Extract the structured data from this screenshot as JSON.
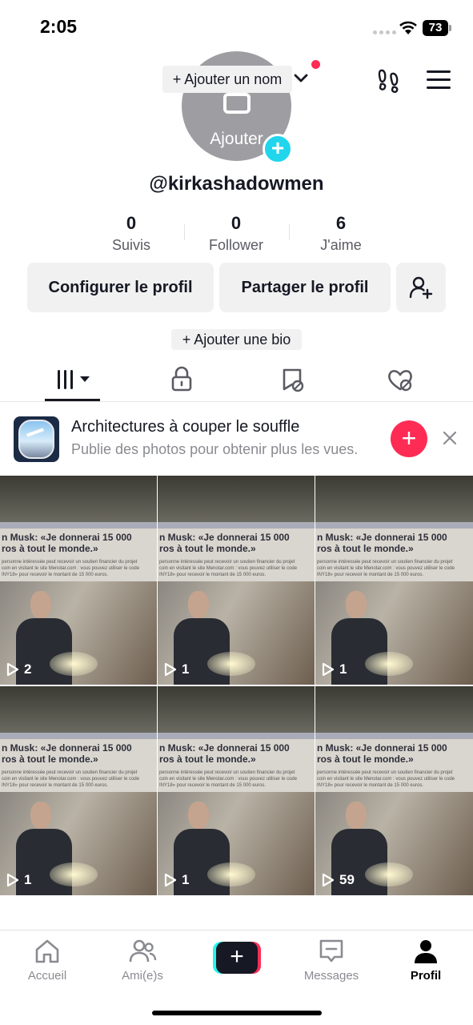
{
  "status_bar": {
    "time": "2:05",
    "battery": "73"
  },
  "profile": {
    "add_name_label": "+ Ajouter un nom",
    "avatar_label": "Ajouter",
    "username": "@kirkashadowmen",
    "add_bio_label": "+ Ajouter une bio"
  },
  "stats": [
    {
      "value": "0",
      "label": "Suivis"
    },
    {
      "value": "0",
      "label": "Follower"
    },
    {
      "value": "6",
      "label": "J'aime"
    }
  ],
  "actions": {
    "edit_profile": "Configurer le profil",
    "share_profile": "Partager le profil"
  },
  "tabs": [
    {
      "icon": "grid-icon",
      "active": true
    },
    {
      "icon": "lock-icon",
      "active": false
    },
    {
      "icon": "bookmark-icon",
      "active": false
    },
    {
      "icon": "liked-heart-icon",
      "active": false
    }
  ],
  "banner": {
    "title": "Architectures à couper le souffle",
    "subtitle": "Publie des photos pour obtenir plus les vues."
  },
  "video_tile": {
    "headline_1": "n Musk: «Je donnerai 15 000",
    "headline_2": "ros à tout le monde.»",
    "body_1": "personne intéressée peut recevoir un soutien financier du projet",
    "body_2": "coin en visitant le site Menotar.com : vous pouvez utiliser le code",
    "body_3": "INY18» pour recevoir le montant de 15 000 euros."
  },
  "videos": [
    {
      "views": "2"
    },
    {
      "views": "1"
    },
    {
      "views": "1"
    },
    {
      "views": "1"
    },
    {
      "views": "1"
    },
    {
      "views": "59"
    }
  ],
  "bottom_nav": [
    {
      "label": "Accueil",
      "icon": "home-icon",
      "active": false
    },
    {
      "label": "Ami(e)s",
      "icon": "friends-icon",
      "active": false
    },
    {
      "label": "",
      "icon": "create-plus-icon",
      "active": false
    },
    {
      "label": "Messages",
      "icon": "messages-icon",
      "active": false
    },
    {
      "label": "Profil",
      "icon": "profile-icon",
      "active": true
    }
  ],
  "colors": {
    "accent": "#fe2c55",
    "cyan": "#20d5ec",
    "text": "#161823",
    "chip": "#f1f1f2"
  }
}
